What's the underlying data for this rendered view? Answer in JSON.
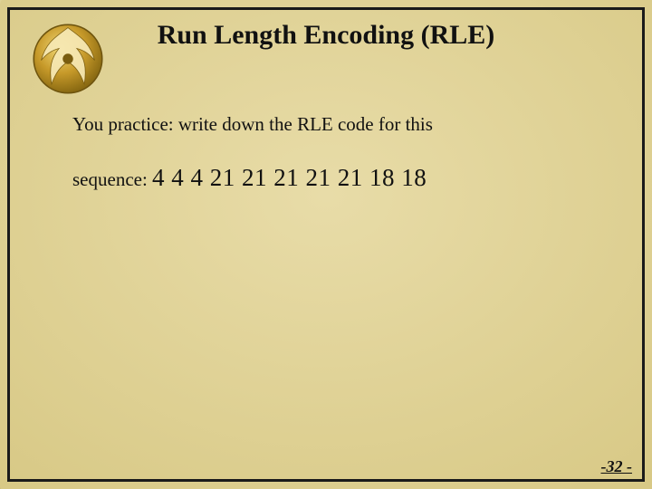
{
  "title": "Run Length Encoding (RLE)",
  "body": {
    "line1": "You practice: write down the RLE code for this",
    "sequence_label": "sequence: ",
    "sequence_values": "4 4 4   21 21 21 21 21   18 18"
  },
  "page_number": "-32 -",
  "logo": {
    "name": "ucf-pegasus-logo",
    "primary": "#c79a2a",
    "secondary": "#8a6a12",
    "highlight": "#f2d978"
  }
}
